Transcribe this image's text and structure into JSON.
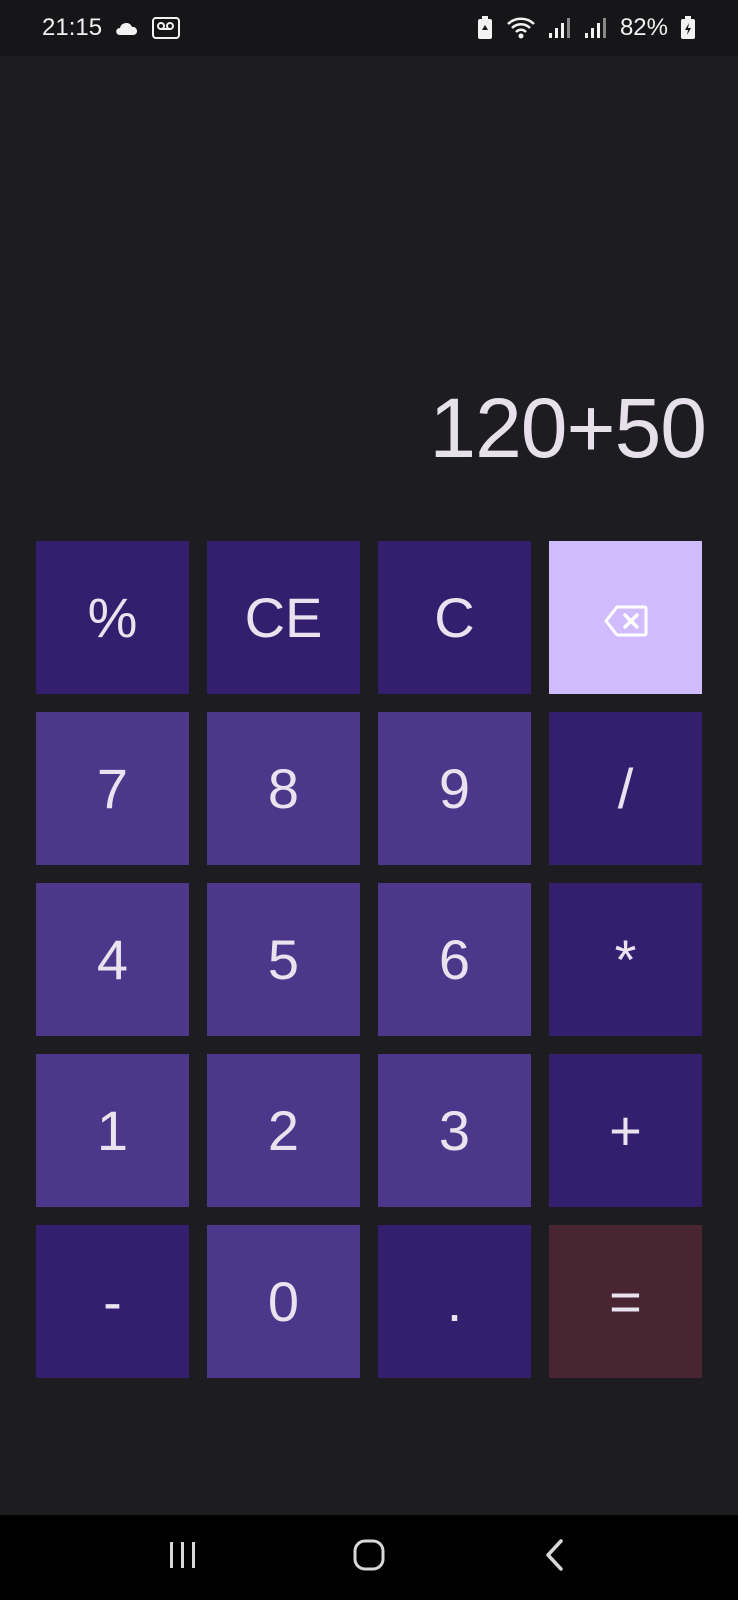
{
  "status_bar": {
    "time": "21:15",
    "battery": "82%",
    "icons": [
      "cloud-icon",
      "voicemail-icon",
      "battery-saver-icon",
      "wifi-icon",
      "signal-icon",
      "signal-icon",
      "battery-charging-icon"
    ]
  },
  "display": {
    "expression": "120+50"
  },
  "keypad": {
    "rows": [
      [
        {
          "label": "%",
          "style": "fn",
          "name": "percent-key"
        },
        {
          "label": "CE",
          "style": "fn",
          "name": "clear-entry-key"
        },
        {
          "label": "C",
          "style": "fn",
          "name": "clear-key"
        },
        {
          "label": "",
          "style": "back",
          "name": "backspace-key",
          "icon": "backspace-icon"
        }
      ],
      [
        {
          "label": "7",
          "style": "num",
          "name": "digit-7-key"
        },
        {
          "label": "8",
          "style": "num",
          "name": "digit-8-key"
        },
        {
          "label": "9",
          "style": "num",
          "name": "digit-9-key"
        },
        {
          "label": "/",
          "style": "fn",
          "name": "divide-key"
        }
      ],
      [
        {
          "label": "4",
          "style": "num",
          "name": "digit-4-key"
        },
        {
          "label": "5",
          "style": "num",
          "name": "digit-5-key"
        },
        {
          "label": "6",
          "style": "num",
          "name": "digit-6-key"
        },
        {
          "label": "*",
          "style": "fn",
          "name": "multiply-key"
        }
      ],
      [
        {
          "label": "1",
          "style": "num",
          "name": "digit-1-key"
        },
        {
          "label": "2",
          "style": "num",
          "name": "digit-2-key"
        },
        {
          "label": "3",
          "style": "num",
          "name": "digit-3-key"
        },
        {
          "label": "+",
          "style": "fn",
          "name": "add-key"
        }
      ],
      [
        {
          "label": "-",
          "style": "fn",
          "name": "subtract-key"
        },
        {
          "label": "0",
          "style": "num",
          "name": "digit-0-key"
        },
        {
          "label": ".",
          "style": "fn",
          "name": "decimal-key"
        },
        {
          "label": "=",
          "style": "eq",
          "name": "equals-key"
        }
      ]
    ]
  },
  "colors": {
    "background": "#1d1c21",
    "function_key": "#341f6e",
    "number_key": "#4d378b",
    "backspace_key": "#d0bcff",
    "equals_key": "#492532",
    "text": "#e8e3ee"
  },
  "nav_bar": {
    "buttons": [
      "recent-apps-icon",
      "home-icon",
      "back-icon"
    ]
  }
}
